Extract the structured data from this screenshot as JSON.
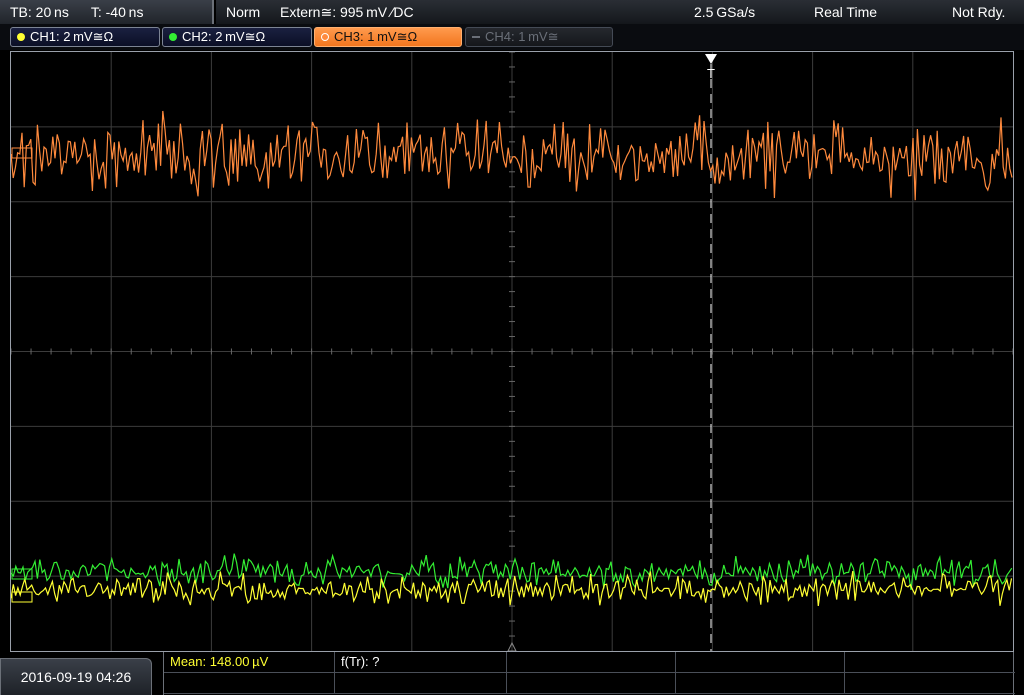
{
  "header": {
    "timebase": "TB: 20 ns",
    "time_offset": "T: -40 ns",
    "trigger_mode": "Norm",
    "trigger_source": "Extern≅: 995 mV ∕DC",
    "sample_rate": "2.5 GSa/s",
    "acq_mode": "Real Time",
    "status": "Not Rdy."
  },
  "channels": [
    {
      "label": "CH1: 2 mV≅Ω",
      "color": "#ffff33",
      "state": "on"
    },
    {
      "label": "CH2: 2 mV≅Ω",
      "color": "#33ee33",
      "state": "on"
    },
    {
      "label": "CH3: 1 mV≅Ω",
      "color": "#ff8a3d",
      "state": "active"
    },
    {
      "label": "CH4: 1 mV≅",
      "color": "#6a6f78",
      "state": "off"
    }
  ],
  "trigger_marker": "T",
  "footer": {
    "datetime": "2016-09-19 04:26",
    "mean": "Mean: 148.00 µV",
    "freq": "f(Tr): ?"
  },
  "colors": {
    "ch1": "#ffff33",
    "ch2": "#33ee33",
    "ch3": "#ff8a3d",
    "grid": "#3c3c3c",
    "trigger_line": "#ffffff"
  }
}
